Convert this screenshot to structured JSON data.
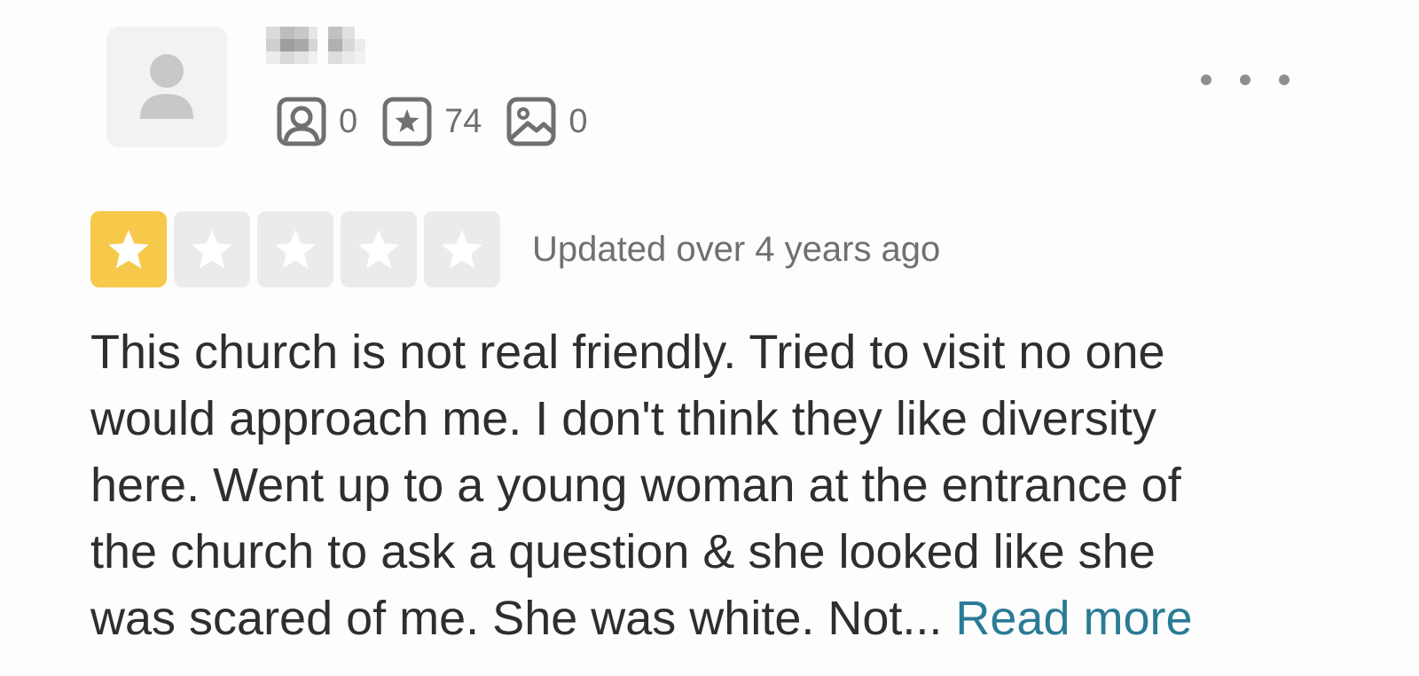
{
  "user": {
    "avatar_icon": "person-silhouette-icon",
    "name_blurred": true,
    "stats": [
      {
        "icon": "friends-icon",
        "value": "0"
      },
      {
        "icon": "reviews-star-icon",
        "value": "74"
      },
      {
        "icon": "photos-icon",
        "value": "0"
      }
    ]
  },
  "menu": {
    "icon": "more-options-icon"
  },
  "rating": {
    "stars": 1,
    "max_stars": 5,
    "filled_color": "#f7c94a",
    "empty_color": "#ebebeb"
  },
  "review": {
    "updated": "Updated over 4 years ago",
    "text": "This church is not real friendly.  Tried to visit no one\nwould approach me.  I don't think they like diversity\nhere.  Went up to a young woman at the entrance of\nthe church to ask a question & she looked like she\nwas scared of me.   She was white.  Not... ",
    "read_more": "Read more",
    "link_color": "#2a7b96"
  }
}
